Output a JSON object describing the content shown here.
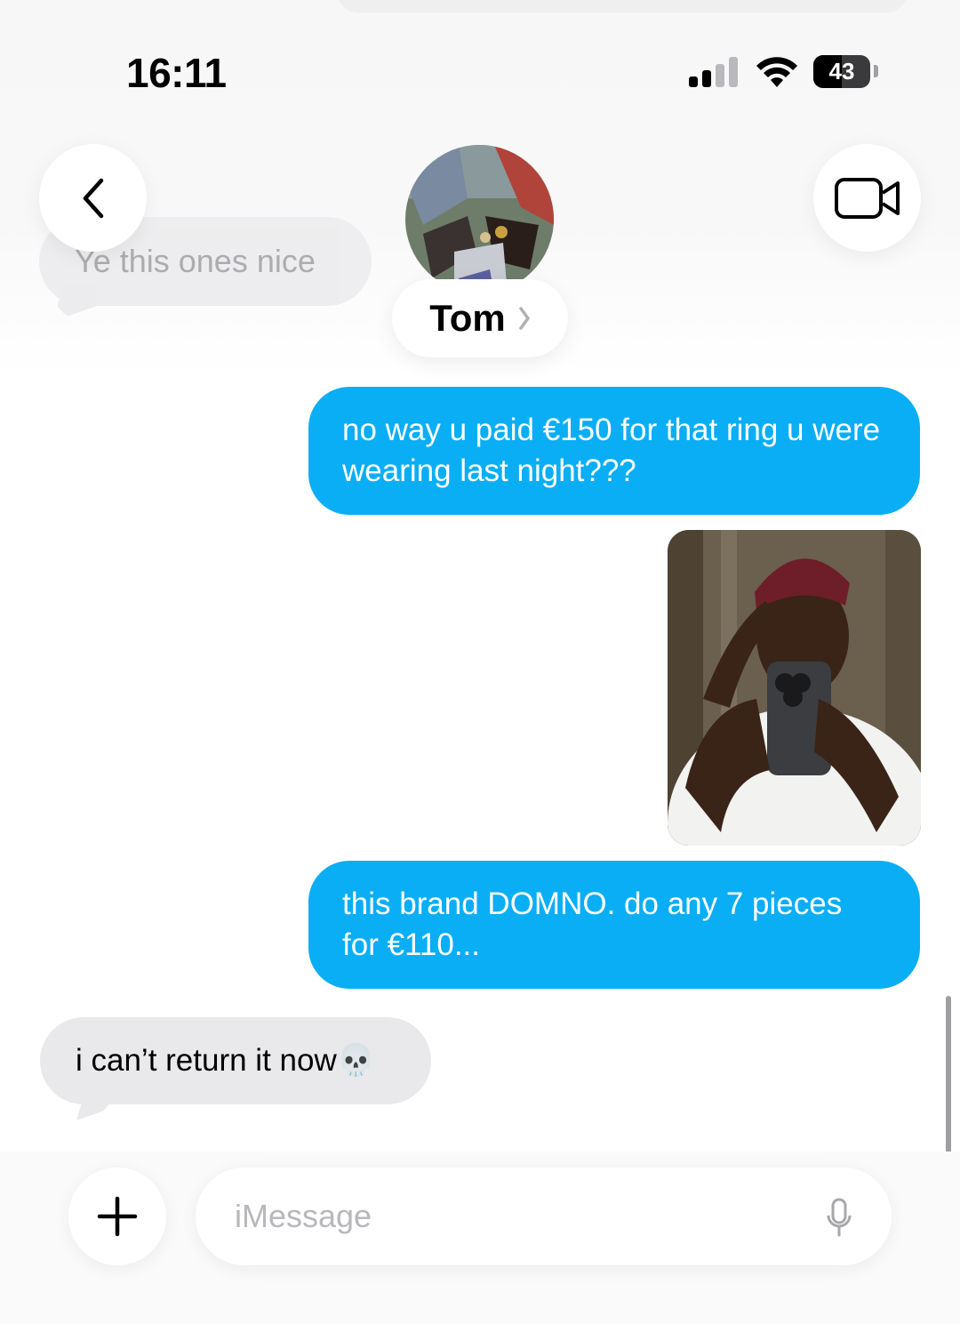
{
  "status_bar": {
    "time": "16:11",
    "battery": "43",
    "signal_bars": 2
  },
  "header": {
    "contact_name": "Tom",
    "back_icon": "chevron-left-icon",
    "video_icon": "video-camera-icon",
    "disclosure_icon": "chevron-right-icon"
  },
  "previous_message": {
    "text": "Ye this ones nice"
  },
  "messages": [
    {
      "direction": "sent",
      "type": "text",
      "text": "no way u paid €150 for that ring u were wearing last night???"
    },
    {
      "direction": "sent",
      "type": "image",
      "description": "photo"
    },
    {
      "direction": "sent",
      "type": "text",
      "text": "this brand DOMNO. do any 7 pieces for €110..."
    },
    {
      "direction": "received",
      "type": "text",
      "text": "i can’t return it now💀"
    }
  ],
  "composer": {
    "placeholder": "iMessage",
    "value": "",
    "add_icon": "plus-icon",
    "mic_icon": "microphone-icon"
  },
  "colors": {
    "sent_bubble": "#0aaef5",
    "received_bubble": "#e9e9eb",
    "background": "#ffffff"
  }
}
